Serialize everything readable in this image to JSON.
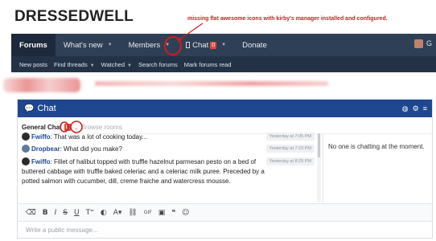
{
  "site": {
    "title": "DRESSEDWELL"
  },
  "annotation": {
    "text": "missing flat awesome icons with kirby's manager installed and configured."
  },
  "nav": {
    "tabs": [
      {
        "label": "Forums"
      },
      {
        "label": "What's new"
      },
      {
        "label": "Members"
      },
      {
        "label": "Chat",
        "badge": "0"
      },
      {
        "label": "Donate"
      }
    ],
    "right_label": "G"
  },
  "subnav": {
    "items": [
      {
        "label": "New posts"
      },
      {
        "label": "Find threads"
      },
      {
        "label": "Watched"
      },
      {
        "label": "Search forums"
      },
      {
        "label": "Mark forums read"
      }
    ]
  },
  "chat": {
    "title": "Chat",
    "room": {
      "name": "General Chat",
      "badge": "0",
      "browse": "Browse rooms"
    },
    "messages": [
      {
        "user": "Fwiffo",
        "text": ": That was a lot of cooking today...",
        "time": "Yesterday at 7:05 PM"
      },
      {
        "user": "Dropbear",
        "text": ": What did you make?",
        "time": "Yesterday at 7:23 PM"
      },
      {
        "user": "Fwiffo",
        "text": ": Fillet of halibut topped with truffle hazelnut parmesan pesto on a bed of buttered cabbage with truffle baked celeriac and a celeriac milk puree. Preceded by a potted salmon with cucumber, dill, creme fraiche and watercress mousse.",
        "time": "Yesterday at 8:29 PM"
      }
    ],
    "sidebar_text": "No one is chatting at the moment.",
    "input_placeholder": "Write a public message..."
  },
  "colors": {
    "header_blue": "#1f4790",
    "nav_dark": "#2f3f55",
    "annotation_red": "#d21c1c"
  }
}
